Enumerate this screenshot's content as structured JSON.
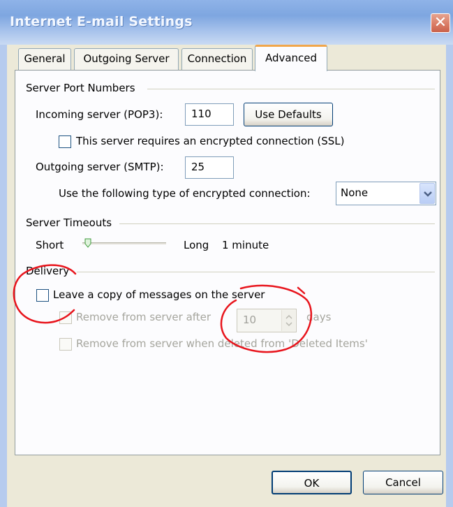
{
  "window": {
    "title": "Internet E-mail Settings"
  },
  "tabs": [
    "General",
    "Outgoing Server",
    "Connection",
    "Advanced"
  ],
  "ports": {
    "group_label": "Server Port Numbers",
    "incoming_label": "Incoming server (POP3):",
    "incoming_value": "110",
    "defaults_button": "Use Defaults",
    "ssl_label": "This server requires an encrypted connection (SSL)",
    "outgoing_label": "Outgoing server (SMTP):",
    "outgoing_value": "25",
    "encryption_label": "Use the following type of encrypted connection:",
    "encryption_value": "None"
  },
  "timeouts": {
    "group_label": "Server Timeouts",
    "short_label": "Short",
    "long_label": "Long",
    "value_label": "1 minute"
  },
  "delivery": {
    "group_label": "Delivery",
    "leave_copy_label": "Leave a copy of messages on the server",
    "remove_after_label": "Remove from server after",
    "days_value": "10",
    "days_label": "days",
    "remove_deleted_label": "Remove from server when deleted from 'Deleted Items'"
  },
  "buttons": {
    "ok": "OK",
    "cancel": "Cancel"
  },
  "colors": {
    "annotation": "#e8141c",
    "active_tab_accent": "#f1a64a"
  }
}
